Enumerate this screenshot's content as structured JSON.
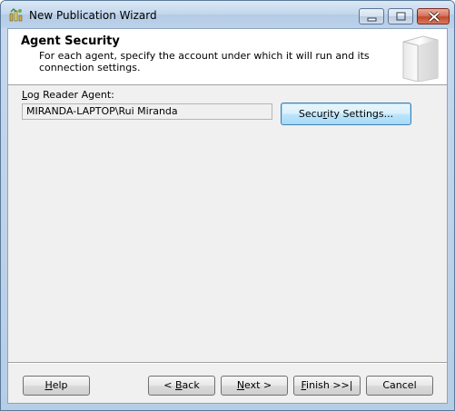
{
  "window": {
    "title": "New Publication Wizard"
  },
  "header": {
    "title": "Agent Security",
    "description": "For each agent, specify the account under which it will run and its connection settings."
  },
  "log_reader": {
    "label_mnemonic": "L",
    "label_rest": "og Reader Agent:",
    "account_value": "MIRANDA-LAPTOP\\Rui Miranda",
    "security_button": {
      "pre": "Secu",
      "mnemonic": "r",
      "post": "ity Settings..."
    }
  },
  "buttons": {
    "help": {
      "mnemonic": "H",
      "rest": "elp"
    },
    "back": {
      "pre": "< ",
      "mnemonic": "B",
      "rest": "ack"
    },
    "next": {
      "mnemonic": "N",
      "rest": "ext >"
    },
    "finish": {
      "mnemonic": "F",
      "rest": "inish >>|"
    },
    "cancel": {
      "label": "Cancel"
    }
  }
}
